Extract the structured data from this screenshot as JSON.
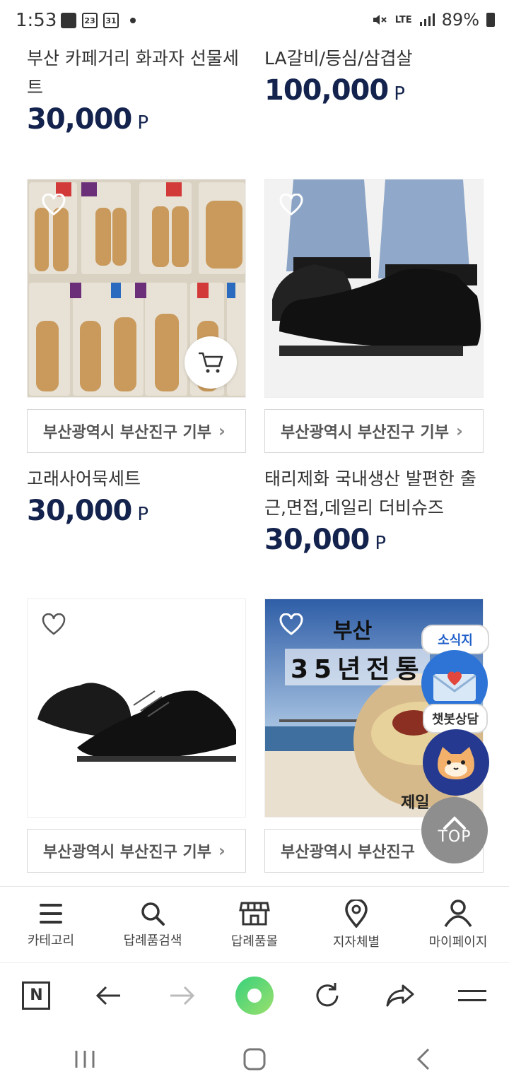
{
  "status": {
    "time": "1:53",
    "cal_day": "23",
    "cal_day2": "31",
    "battery": "89%",
    "net": "LTE"
  },
  "products": [
    {
      "name": "부산 카페거리 화과자 선물세트",
      "price": "30,000",
      "unit": "P"
    },
    {
      "name": "LA갈비/등심/삼겹살",
      "price": "100,000",
      "unit": "P"
    },
    {
      "name": "고래사어묵세트",
      "price": "30,000",
      "unit": "P",
      "tag": "부산광역시 부산진구 기부",
      "image": "fishcake-image"
    },
    {
      "name": "태리제화 국내생산 발편한 출근,면접,데일리 더비슈즈",
      "price": "30,000",
      "unit": "P",
      "tag": "부산광역시 부산진구 기부",
      "image": "derby-shoe-image"
    },
    {
      "tag": "부산광역시 부산진구 기부",
      "image": "oxford-shoe-image"
    },
    {
      "tag": "부산광역시 부산진구",
      "image": "busan-noodle-banner",
      "banner_title": "부산",
      "banner_sub": "35년전통",
      "banner_brand": "제일"
    }
  ],
  "floating": {
    "news_label": "소식지",
    "chatbot_label": "챗봇상담",
    "top_label": "TOP"
  },
  "bottom_nav": [
    {
      "label": "카테고리",
      "icon": "menu-icon"
    },
    {
      "label": "답례품검색",
      "icon": "search-icon"
    },
    {
      "label": "답례품몰",
      "icon": "store-icon"
    },
    {
      "label": "지자체별",
      "icon": "location-pin-icon"
    },
    {
      "label": "마이페이지",
      "icon": "person-icon"
    }
  ],
  "browser": {
    "home_label": "N"
  },
  "colors": {
    "price": "#13234d",
    "accent_green": "#37d17c",
    "news_blue": "#1f5fc8"
  }
}
